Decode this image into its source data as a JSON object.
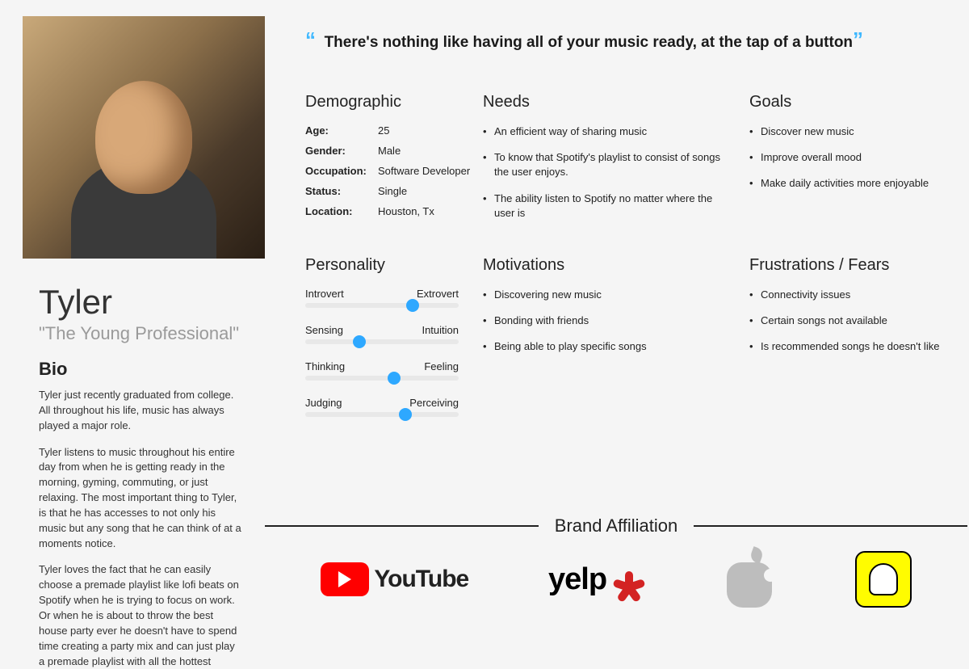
{
  "persona": {
    "name": "Tyler",
    "tagline": "\"The Young Professional\"",
    "bio_title": "Bio",
    "bio_paragraphs": [
      "Tyler just recently graduated from college. All throughout his life, music has always played a major role.",
      "Tyler listens to music throughout his entire day from when he is getting ready in the morning, gyming, commuting, or just relaxing. The most important thing to Tyler, is that he has accesses to not only his music but any song that he can think of at a moments notice.",
      "Tyler loves the fact that he can easily choose a premade playlist like lofi beats on Spotify when he is trying to focus on work. Or when he is about to throw the best house party ever he doesn't have to spend time creating a party mix and can just play a premade playlist with all the hottest"
    ]
  },
  "quote": "There's nothing like having all of your music ready, at the tap of a button",
  "sections": {
    "demographic": {
      "title": "Demographic",
      "rows": [
        {
          "label": "Age:",
          "value": "25"
        },
        {
          "label": "Gender:",
          "value": "Male"
        },
        {
          "label": "Occupation:",
          "value": "Software Developer"
        },
        {
          "label": "Status:",
          "value": "Single"
        },
        {
          "label": "Location:",
          "value": "Houston, Tx"
        }
      ]
    },
    "needs": {
      "title": "Needs",
      "items": [
        "An efficient way of sharing music",
        "To know that Spotify's playlist to consist of songs the user enjoys.",
        "The ability listen to Spotify no matter where the user is"
      ]
    },
    "goals": {
      "title": "Goals",
      "items": [
        "Discover new music",
        "Improve overall mood",
        "Make daily activities more enjoyable"
      ]
    },
    "personality": {
      "title": "Personality",
      "traits": [
        {
          "left": "Introvert",
          "right": "Extrovert",
          "pos": 70
        },
        {
          "left": "Sensing",
          "right": "Intuition",
          "pos": 35
        },
        {
          "left": "Thinking",
          "right": "Feeling",
          "pos": 58
        },
        {
          "left": "Judging",
          "right": "Perceiving",
          "pos": 65
        }
      ]
    },
    "motivations": {
      "title": "Motivations",
      "items": [
        "Discovering new music",
        "Bonding with friends",
        "Being able to play specific songs"
      ]
    },
    "frustrations": {
      "title": "Frustrations / Fears",
      "items": [
        "Connectivity issues",
        "Certain songs not available",
        "Is recommended songs he doesn't like"
      ]
    }
  },
  "brand": {
    "title": "Brand Affiliation",
    "logos": {
      "youtube": "YouTube",
      "yelp": "yelp",
      "apple": "Apple",
      "snapchat": "Snapchat"
    }
  }
}
